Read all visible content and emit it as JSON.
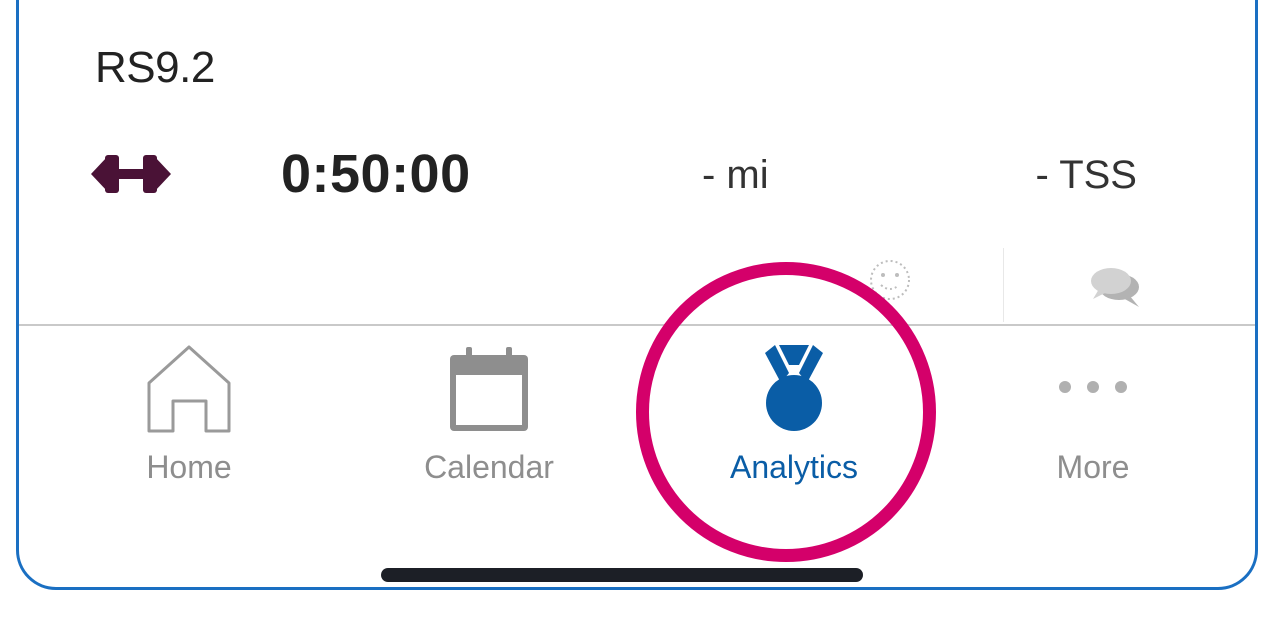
{
  "workout": {
    "title": "RS9.2",
    "sport_icon": "dumbbell-icon",
    "duration": "0:50:00",
    "distance": "- mi",
    "tss": "- TSS"
  },
  "actions": {
    "feel_icon": "smiley-face-icon",
    "comment_icon": "comment-bubbles-icon"
  },
  "tabbar": {
    "tabs": [
      {
        "label": "Home",
        "icon": "home-icon",
        "active": false
      },
      {
        "label": "Calendar",
        "icon": "calendar-icon",
        "active": false
      },
      {
        "label": "Analytics",
        "icon": "medal-icon",
        "active": true
      },
      {
        "label": "More",
        "icon": "more-dots-icon",
        "active": false
      }
    ]
  },
  "colors": {
    "accent": "#0a5da6",
    "inactive": "#8e8e8e",
    "sport_icon": "#4a1236",
    "highlight_ring": "#d4006a",
    "frame_border": "#1a6fc2"
  }
}
